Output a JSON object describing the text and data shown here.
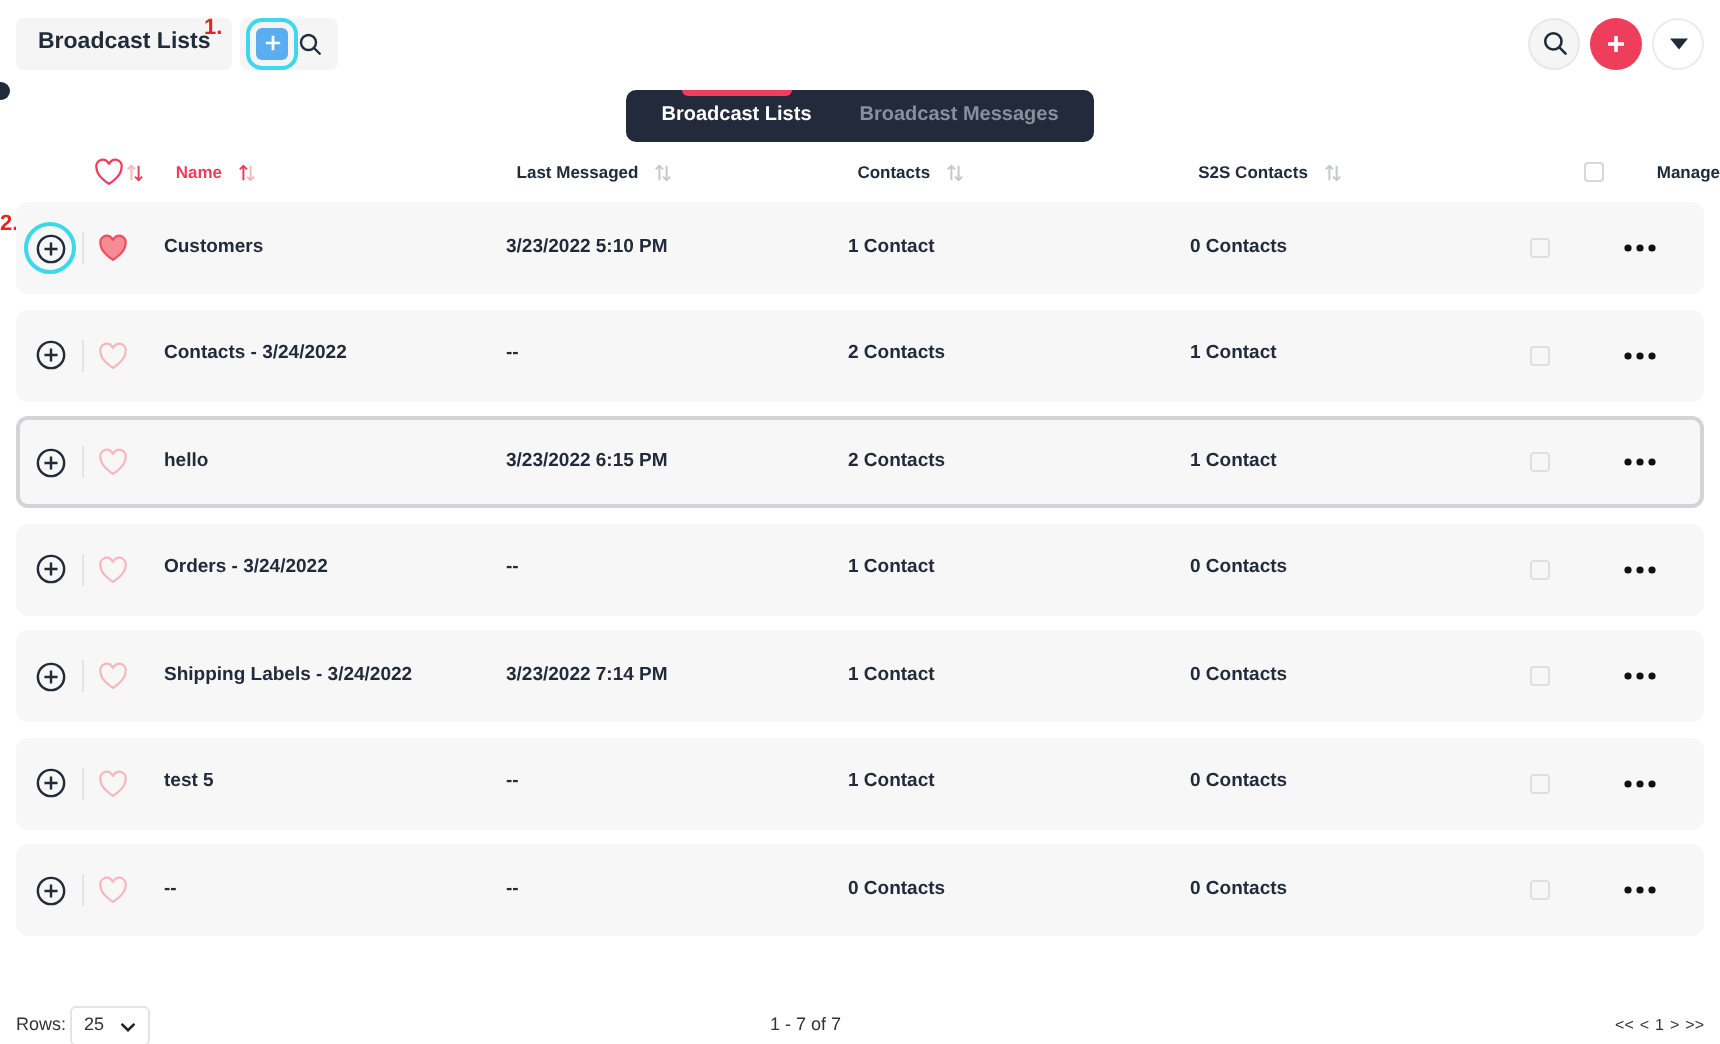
{
  "header": {
    "title": "Broadcast Lists",
    "annotation": "1."
  },
  "tabs": [
    {
      "label": "Broadcast Lists",
      "selected": true
    },
    {
      "label": "Broadcast Messages",
      "selected": false
    }
  ],
  "table": {
    "columns": [
      {
        "label": "Name",
        "active": true
      },
      {
        "label": "Last Messaged",
        "active": false
      },
      {
        "label": "Contacts",
        "active": false
      },
      {
        "label": "S2S Contacts",
        "active": false
      },
      {
        "label": "Manage",
        "active": false
      }
    ],
    "row_annotation": "2.",
    "select_all_checked": false,
    "rows": [
      {
        "name": "Customers",
        "last_messaged": "3/23/2022 5:10 PM",
        "contacts": "1 Contact",
        "s2s_contacts": "0 Contacts",
        "favorite": true,
        "hovered": false
      },
      {
        "name": "Contacts - 3/24/2022",
        "last_messaged": "--",
        "contacts": "2 Contacts",
        "s2s_contacts": "1 Contact",
        "favorite": false,
        "hovered": false
      },
      {
        "name": "hello",
        "last_messaged": "3/23/2022 6:15 PM",
        "contacts": "2 Contacts",
        "s2s_contacts": "1 Contact",
        "favorite": false,
        "hovered": true
      },
      {
        "name": "Orders - 3/24/2022",
        "last_messaged": "--",
        "contacts": "1 Contact",
        "s2s_contacts": "0 Contacts",
        "favorite": false,
        "hovered": false
      },
      {
        "name": "Shipping Labels - 3/24/2022",
        "last_messaged": "3/23/2022 7:14 PM",
        "contacts": "1 Contact",
        "s2s_contacts": "0 Contacts",
        "favorite": false,
        "hovered": false
      },
      {
        "name": "test 5",
        "last_messaged": "--",
        "contacts": "1 Contact",
        "s2s_contacts": "0 Contacts",
        "favorite": false,
        "hovered": false
      },
      {
        "name": "--",
        "last_messaged": "--",
        "contacts": "0 Contacts",
        "s2s_contacts": "0 Contacts",
        "favorite": false,
        "hovered": false
      }
    ]
  },
  "footer": {
    "rows_label": "Rows:",
    "rows_value": "25",
    "range": "1 - 7 of 7",
    "pages": [
      "<<",
      "<",
      "1",
      ">",
      ">>"
    ]
  }
}
